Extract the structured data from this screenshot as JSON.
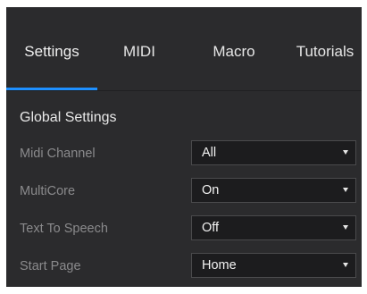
{
  "tabs": [
    {
      "label": "Settings",
      "active": true
    },
    {
      "label": "MIDI",
      "active": false
    },
    {
      "label": "Macro",
      "active": false
    },
    {
      "label": "Tutorials",
      "active": false
    }
  ],
  "section": {
    "title": "Global Settings"
  },
  "settings": [
    {
      "label": "Midi Channel",
      "value": "All"
    },
    {
      "label": "MultiCore",
      "value": "On"
    },
    {
      "label": "Text To Speech",
      "value": "Off"
    },
    {
      "label": "Start Page",
      "value": "Home"
    }
  ],
  "colors": {
    "panel_background": "#2b2b2d",
    "active_tab_indicator": "#1e90ff",
    "dropdown_background": "#1c1c1e",
    "label_text": "#8a8a8c"
  },
  "icons": {
    "dropdown_caret": "chevron-down-icon"
  }
}
